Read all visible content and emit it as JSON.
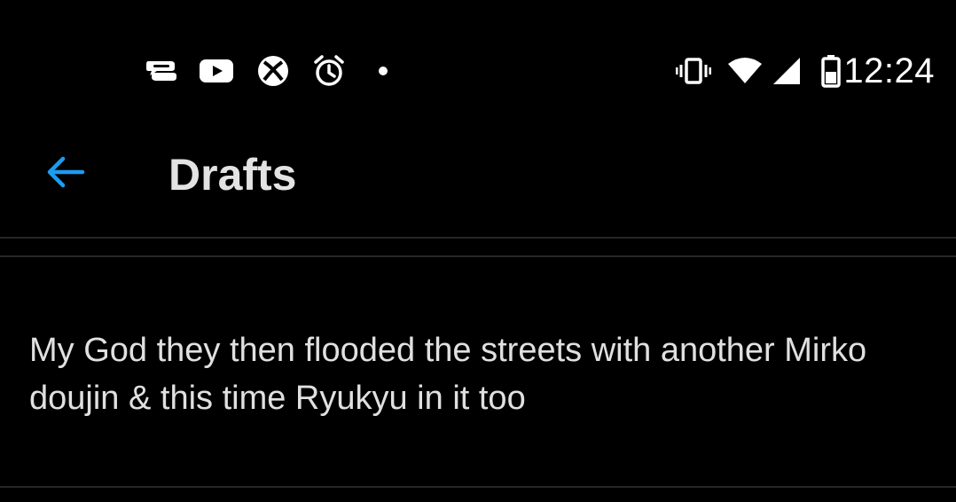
{
  "status_bar": {
    "time": "12:24",
    "notification_icons": [
      "messenger-icon",
      "youtube-icon",
      "xbox-icon",
      "alarm-icon",
      "more-notifications-dot"
    ],
    "system_icons": [
      "vibrate-icon",
      "wifi-icon",
      "cellular-signal-icon",
      "battery-icon"
    ]
  },
  "app_bar": {
    "title": "Drafts",
    "back_icon": "arrow-left-icon",
    "accent_color": "#1d9bf0"
  },
  "drafts": [
    {
      "text": "My God they then flooded the streets with another Mirko doujin & this time Ryukyu in it too"
    }
  ],
  "colors": {
    "background": "#000000",
    "text": "#e6e6e6",
    "divider": "#262626"
  }
}
